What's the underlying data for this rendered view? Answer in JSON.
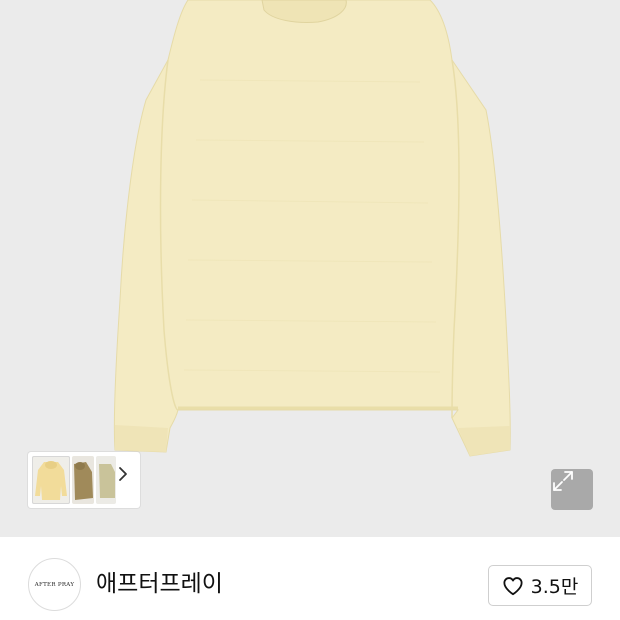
{
  "product": {
    "image": "cream-long-sleeve-shirt-photo",
    "image_color": "#f4ebc3",
    "background_color": "#ebebeb"
  },
  "thumbnails": {
    "items": [
      {
        "name": "cream-hoodie-thumbnail",
        "color": "#f2dc9a",
        "selected": true
      },
      {
        "name": "olive-hoodie-thumbnail",
        "color": "#a08a5a",
        "selected": false
      },
      {
        "name": "khaki-shirt-thumbnail",
        "color": "#c9c39a",
        "selected": false
      }
    ],
    "next_icon": "chevron-right-icon"
  },
  "viewer": {
    "expand_icon": "expand-arrows-icon"
  },
  "brand": {
    "logo_text": "AFTER PRAY",
    "name": "애프터프레이",
    "like_icon": "heart-outline-icon",
    "like_count": "3.5만"
  }
}
